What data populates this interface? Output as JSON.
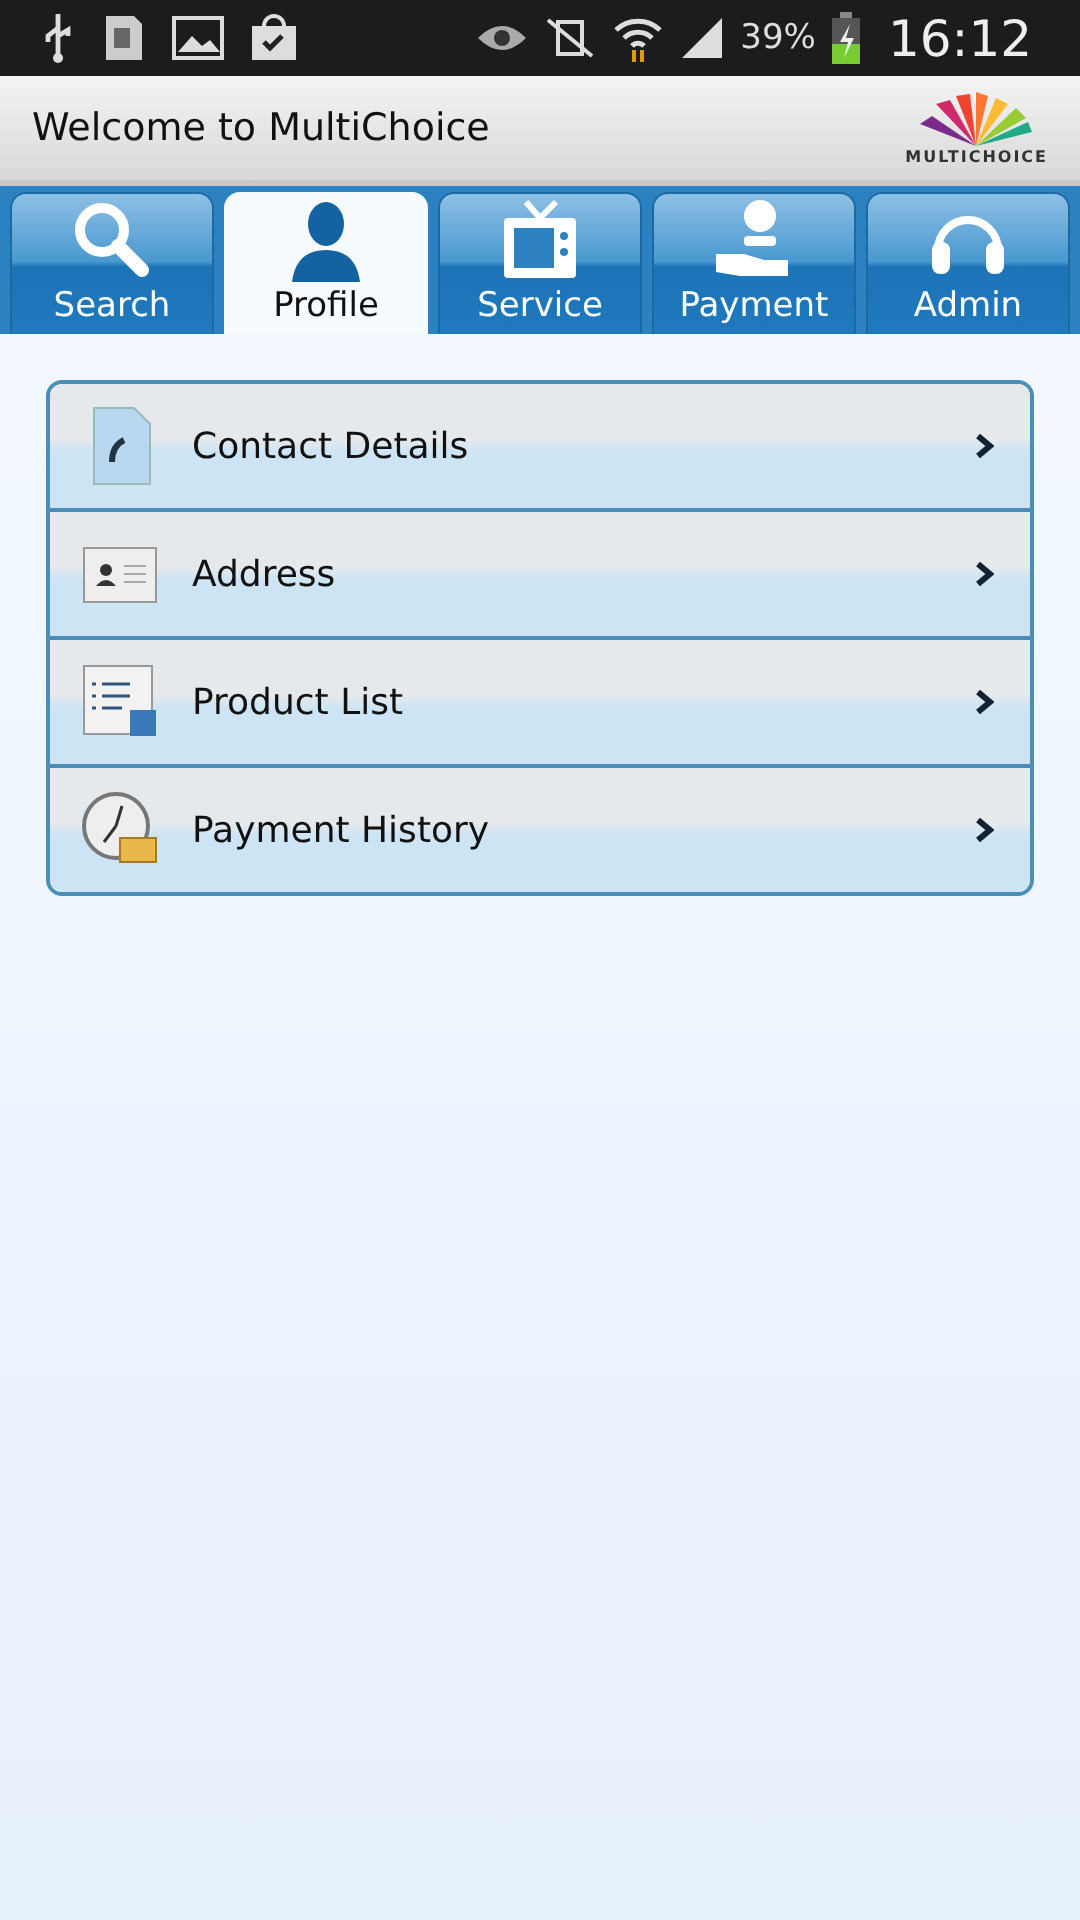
{
  "status_bar": {
    "battery": "39%",
    "time": "16:12"
  },
  "header": {
    "title": "Welcome to MultiChoice",
    "logo_text": "MULTICHOICE"
  },
  "tabs": [
    {
      "label": "Search",
      "kind": "search",
      "selected": false
    },
    {
      "label": "Profile",
      "kind": "person",
      "selected": true
    },
    {
      "label": "Service",
      "kind": "tv",
      "selected": false
    },
    {
      "label": "Payment",
      "kind": "money",
      "selected": false
    },
    {
      "label": "Admin",
      "kind": "headset",
      "selected": false
    }
  ],
  "menu": [
    {
      "label": "Contact Details",
      "kind": "phone"
    },
    {
      "label": "Address",
      "kind": "card"
    },
    {
      "label": "Product List",
      "kind": "list"
    },
    {
      "label": "Payment History",
      "kind": "clock"
    }
  ]
}
